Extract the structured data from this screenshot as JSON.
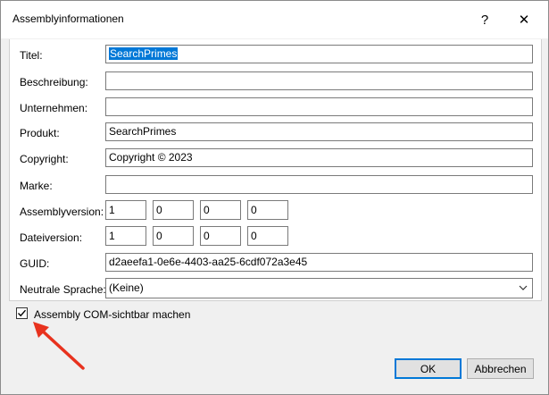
{
  "window": {
    "title": "Assemblyinformationen",
    "help_glyph": "?",
    "close_glyph": "✕"
  },
  "fields": {
    "titel": {
      "label": "Titel:",
      "value": "SearchPrimes"
    },
    "beschreibung": {
      "label": "Beschreibung:",
      "value": ""
    },
    "unternehmen": {
      "label": "Unternehmen:",
      "value": ""
    },
    "produkt": {
      "label": "Produkt:",
      "value": "SearchPrimes"
    },
    "copyright": {
      "label": "Copyright:",
      "value": "Copyright ©  2023"
    },
    "marke": {
      "label": "Marke:",
      "value": ""
    },
    "assemblyversion": {
      "label": "Assemblyversion:",
      "parts": [
        "1",
        "0",
        "0",
        "0"
      ]
    },
    "dateiversion": {
      "label": "Dateiversion:",
      "parts": [
        "1",
        "0",
        "0",
        "0"
      ]
    },
    "guid": {
      "label": "GUID:",
      "value": "d2aeefa1-0e6e-4403-aa25-6cdf072a3e45"
    },
    "sprache": {
      "label": "Neutrale Sprache:",
      "value": "(Keine)"
    }
  },
  "com_visible": {
    "label": "Assembly COM-sichtbar machen",
    "checked": true
  },
  "buttons": {
    "ok": "OK",
    "cancel": "Abbrechen"
  },
  "annotation": {
    "arrow_color": "#e8321e"
  }
}
